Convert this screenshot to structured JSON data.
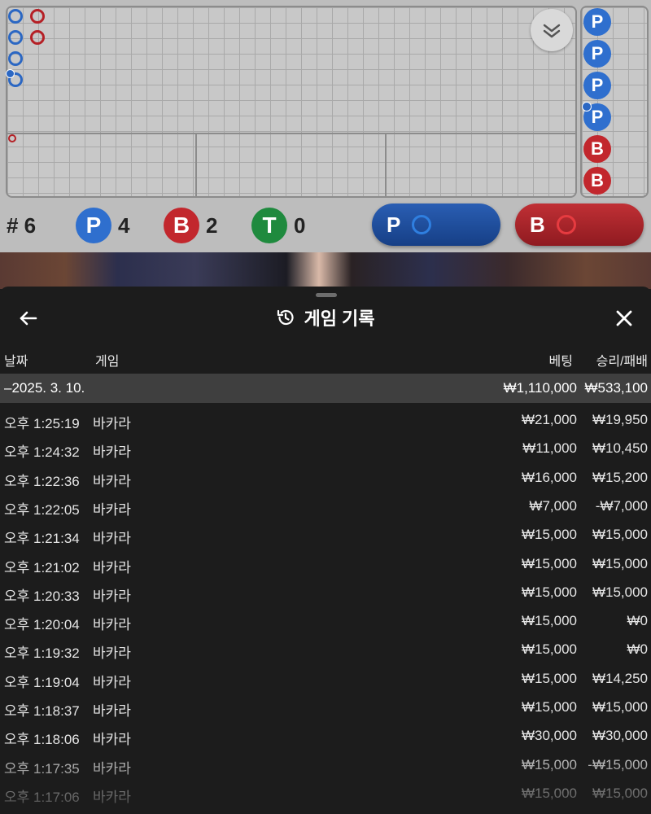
{
  "scoreboard": {
    "total_label": "# 6",
    "player_badge": "P",
    "player_count": "4",
    "banker_badge": "B",
    "banker_count": "2",
    "tie_badge": "T",
    "tie_count": "0",
    "bead_road": [
      "P",
      "P",
      "P",
      "P",
      "B",
      "B"
    ],
    "player_bet_button": "P",
    "banker_bet_button": "B",
    "colors": {
      "player": "#2f6fce",
      "banker": "#c2272d",
      "tie": "#1f8a3e"
    }
  },
  "history": {
    "title": "게임 기록",
    "icons": {
      "back": "arrow-left-icon",
      "title": "history-icon",
      "close": "close-icon"
    },
    "columns": {
      "date": "날짜",
      "game": "게임",
      "bet": "베팅",
      "winloss": "승리/패배"
    },
    "date_group": {
      "date": "–2025. 3. 10.",
      "bet_total": "₩1,110,000",
      "winloss_total": "₩533,100"
    },
    "rows": [
      {
        "time": "오후 1:25:19",
        "game": "바카라",
        "bet": "₩21,000",
        "winloss": "₩19,950"
      },
      {
        "time": "오후 1:24:32",
        "game": "바카라",
        "bet": "₩11,000",
        "winloss": "₩10,450"
      },
      {
        "time": "오후 1:22:36",
        "game": "바카라",
        "bet": "₩16,000",
        "winloss": "₩15,200"
      },
      {
        "time": "오후 1:22:05",
        "game": "바카라",
        "bet": "₩7,000",
        "winloss": "-₩7,000"
      },
      {
        "time": "오후 1:21:34",
        "game": "바카라",
        "bet": "₩15,000",
        "winloss": "₩15,000"
      },
      {
        "time": "오후 1:21:02",
        "game": "바카라",
        "bet": "₩15,000",
        "winloss": "₩15,000"
      },
      {
        "time": "오후 1:20:33",
        "game": "바카라",
        "bet": "₩15,000",
        "winloss": "₩15,000"
      },
      {
        "time": "오후 1:20:04",
        "game": "바카라",
        "bet": "₩15,000",
        "winloss": "₩0"
      },
      {
        "time": "오후 1:19:32",
        "game": "바카라",
        "bet": "₩15,000",
        "winloss": "₩0"
      },
      {
        "time": "오후 1:19:04",
        "game": "바카라",
        "bet": "₩15,000",
        "winloss": "₩14,250"
      },
      {
        "time": "오후 1:18:37",
        "game": "바카라",
        "bet": "₩15,000",
        "winloss": "₩15,000"
      },
      {
        "time": "오후 1:18:06",
        "game": "바카라",
        "bet": "₩30,000",
        "winloss": "₩30,000"
      },
      {
        "time": "오후 1:17:35",
        "game": "바카라",
        "bet": "₩15,000",
        "winloss": "-₩15,000"
      },
      {
        "time": "오후 1:17:06",
        "game": "바카라",
        "bet": "₩15,000",
        "winloss": "₩15,000"
      }
    ]
  }
}
